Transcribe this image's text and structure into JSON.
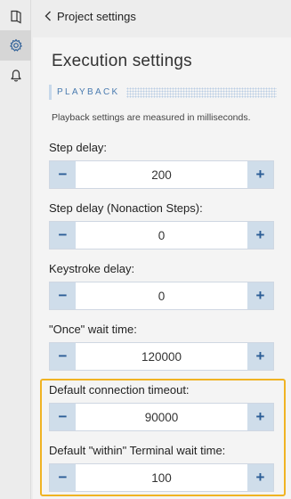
{
  "nav": {
    "back_label": "Project settings",
    "rail_icons": [
      "book-icon",
      "gear-icon",
      "bell-icon"
    ]
  },
  "page": {
    "title": "Execution settings",
    "section_label": "PLAYBACK",
    "description": "Playback settings are measured in milliseconds."
  },
  "fields": [
    {
      "label": "Step delay:",
      "value": "200"
    },
    {
      "label": "Step delay (Nonaction Steps):",
      "value": "0"
    },
    {
      "label": "Keystroke delay:",
      "value": "0"
    },
    {
      "label": "\"Once\" wait time:",
      "value": "120000"
    },
    {
      "label": "Default connection timeout:",
      "value": "90000"
    },
    {
      "label": "Default \"within\" Terminal wait time:",
      "value": "100"
    }
  ],
  "stepper": {
    "decrement": "−",
    "increment": "+"
  },
  "colors": {
    "accent": "#2b5d96",
    "stepper_button": "#cfddea",
    "highlight": "#f0b323"
  }
}
